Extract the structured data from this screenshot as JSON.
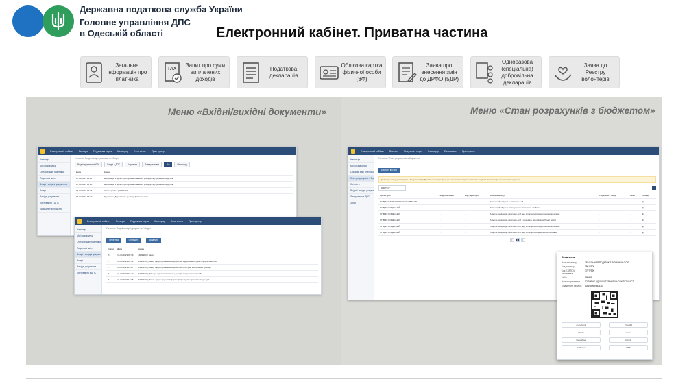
{
  "header": {
    "org_line1": "Державна податкова служба України",
    "org_line2": "Головне управління ДПС",
    "org_line3": "в Одеській області",
    "page_title": "Електронний кабінет. Приватна частина"
  },
  "services": [
    {
      "icon": "person-card-icon",
      "label": "Загальна інформація про платника"
    },
    {
      "icon": "tax-document-icon",
      "label": "Запит про суми виплачених доходів"
    },
    {
      "icon": "declaration-list-icon",
      "label": "Податкова декларація"
    },
    {
      "icon": "id-card-icon",
      "label": "Облікова картка фізичної особи (ЗФ)"
    },
    {
      "icon": "edit-document-icon",
      "label": "Заява про внесення змін до ДРФО (5ДР)"
    },
    {
      "icon": "org-chart-icon",
      "label": "Одноразова (спеціальна) добровільна декларація"
    },
    {
      "icon": "volunteer-hands-icon",
      "label": "Заява до Реєстру волонтерів"
    }
  ],
  "captions": {
    "left": "Меню «Вхідні/вихідні документи»",
    "right": "Меню «Стан розрахунків з бюджетом»"
  },
  "mini_app": {
    "nav": [
      "Електронний кабінет",
      "Реєстри",
      "Податкова карта",
      "Календар",
      "Бази знань",
      "Прес-центр"
    ],
    "sidebar": [
      "Навігація",
      "Мої розрахунки",
      "Облікові дані платника",
      "Податкові звітні",
      "Вхідні / вихідні документи",
      "Вхідні",
      "Вихідні документи",
      "Листування з ДПС",
      "Калькулятор податку"
    ],
    "crumb": "Головна  /  Вхідні/вихідні документи  /  Вхідні",
    "tabs": [
      "Вхідні документи ЄРА",
      "Вхідні з ДПС",
      "Чернетки",
      "Повідомлення",
      "Всі"
    ],
    "button": "Перегляд",
    "columns": [
      "Дата",
      "Назва"
    ],
    "rows": [
      {
        "date": "17.03.2023 16:25",
        "text": "Інформація з ДРФО про суми виплачених доходів та утриманих податків"
      },
      {
        "date": "17.03.2023 16:25",
        "text": "Інформація з ДРФО про суми виплачених доходів та утриманих податків"
      },
      {
        "date": "16.03.2023 16:25",
        "text": "Квитанція № 2 (J1499102)"
      },
      {
        "date": "14.02.2023 15:30",
        "text": "Відомості з Державного реєстру фізичних осіб"
      }
    ]
  },
  "mini_app2": {
    "crumb": "Головна  /  Вхідні/вихідні документи  /  Вхідні",
    "buttons": [
      "Перегляд",
      "Отримати",
      "Видалити"
    ],
    "columns": [
      "Статус",
      "Дата",
      "Назва"
    ],
    "rows": [
      {
        "date": "15.03.2023 09:36",
        "text": "[J0499801] Запит"
      },
      {
        "date": "15.03.2023 09:42",
        "text": "[F1499102] Запит щодо отримання відомостей з Державного реєстру фізичних осіб"
      },
      {
        "date": "16.03.2023 15:27",
        "text": "[F1499103] Запит щодо отримання відомостей про суми виплачених доходів"
      },
      {
        "date": "16.03.2023 15:20",
        "text": "[F1499106] Звіт про суми нарахованих доходів застрахованих осіб"
      },
      {
        "date": "21.03.2023 13:05",
        "text": "[F1499104] Запит щодо надання інформації про суми нарахованих доходів"
      }
    ]
  },
  "budget_app": {
    "crumb": "Головна  /  Стан розрахунків з бюджетом",
    "sidebar": [
      "Навігація",
      "Мої розрахунки",
      "Облікові дані платника",
      "Стан розрахунків з бюджетом",
      "Звітність",
      "Вхідні / вихідні документи",
      "Листування з ДПС",
      "Звіти"
    ],
    "warning": "Дані щодо стану розрахунків з бюджетом відображаються відповідно до інтегрованої картки платника податків. Інформація оновлюється щоденно.",
    "select_value": "ЄДРПОУ",
    "button": "Експорт в Excel",
    "columns": [
      "Орган ДПС",
      "Код платника",
      "Код території",
      "Назва платежу",
      "Переплата / Борг",
      "Пеня",
      "Сальдо"
    ],
    "rows": [
      {
        "org": "ГУ ДПС У ТЕРНОПІЛЬСЬКІЙ ОБЛАСТІ",
        "name": "Земельний податок з фізичних осіб"
      },
      {
        "org": "ГУ ДПС У ОДЕСЬКІЙ",
        "name": "Військовий збір, що сплачується фізичними особами"
      },
      {
        "org": "ГУ ДПС У ОДЕСЬКІЙ",
        "name": "Податок на доходи фізичних осіб, що сплачується податковими агентами"
      },
      {
        "org": "ГУ ДПС У ОДЕСЬКІЙ",
        "name": "Податок на доходи фізичних осіб з доходів у вигляді заробітної плати"
      },
      {
        "org": "ГУ ДПС У ОДЕСЬКІЙ",
        "name": "Податок на доходи фізичних осіб, що сплачується податковими агентами"
      },
      {
        "org": "ГУ ДПС У ОДЕСЬКІЙ",
        "name": "Податок на доходи фізичних осіб, що сплачується фізичними особами"
      }
    ],
    "pages": [
      "<",
      "1",
      ">"
    ]
  },
  "popup": {
    "title": "Реквізити",
    "rows": [
      {
        "k": "Назва платежу",
        "v": "ЗЕМЕЛЬНИЙ ПОДАТОК З ФІЗИЧНИХ ОСІБ"
      },
      {
        "k": "Код платежу",
        "v": "18010500"
      },
      {
        "k": "Код ЄДРПОУ отримувача",
        "v": "37977599"
      },
      {
        "k": "МФО",
        "v": "899998"
      },
      {
        "k": "Назва отримувача",
        "v": "ГОЛОВНЕ УДКСУ У ТЕРНОПІЛЬСЬКІЙ ОБЛАСТІ"
      },
      {
        "k": "Бюджетний рахунок",
        "v": "UA698999980334"
      }
    ],
    "banks": [
      "monobank",
      "Privat24",
      "ПУМБ",
      "sense",
      "Ощадбанк",
      "izibank",
      "Raiffeisen",
      "MTB"
    ]
  }
}
